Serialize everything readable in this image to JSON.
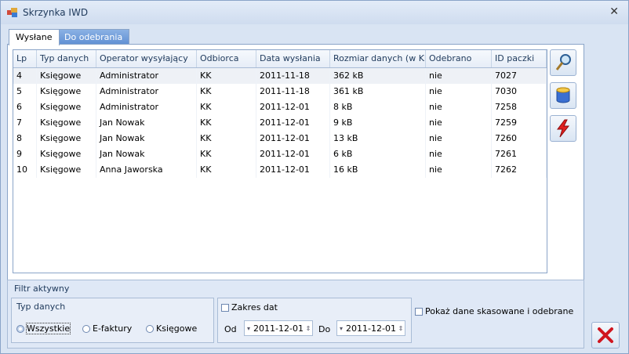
{
  "window": {
    "title": "Skrzynka IWD"
  },
  "tabs": [
    {
      "label": "Wysłane"
    },
    {
      "label": "Do odebrania"
    }
  ],
  "grid": {
    "columns": [
      "Lp",
      "Typ danych",
      "Operator wysyłający",
      "Odbiorca",
      "Data wysłania",
      "Rozmiar danych (w KB)",
      "Odebrano",
      "ID paczki"
    ],
    "rows": [
      [
        "4",
        "Księgowe",
        "Administrator",
        "KK",
        "2011-11-18",
        "362 kB",
        "nie",
        "7027"
      ],
      [
        "5",
        "Księgowe",
        "Administrator",
        "KK",
        "2011-11-18",
        "361 kB",
        "nie",
        "7030"
      ],
      [
        "6",
        "Księgowe",
        "Administrator",
        "KK",
        "2011-12-01",
        "8 kB",
        "nie",
        "7258"
      ],
      [
        "7",
        "Księgowe",
        "Jan Nowak",
        "KK",
        "2011-12-01",
        "9 kB",
        "nie",
        "7259"
      ],
      [
        "8",
        "Księgowe",
        "Jan Nowak",
        "KK",
        "2011-12-01",
        "13 kB",
        "nie",
        "7260"
      ],
      [
        "9",
        "Księgowe",
        "Jan Nowak",
        "KK",
        "2011-12-01",
        "6 kB",
        "nie",
        "7261"
      ],
      [
        "10",
        "Księgowe",
        "Anna Jaworska",
        "KK",
        "2011-12-01",
        "16 kB",
        "nie",
        "7262"
      ]
    ]
  },
  "side_buttons": [
    "search-icon",
    "database-icon",
    "lightning-icon"
  ],
  "filter": {
    "title": "Filtr aktywny",
    "type_group": {
      "title": "Typ danych",
      "options": [
        "Wszystkie",
        "E-faktury",
        "Księgowe"
      ],
      "selected": "Wszystkie"
    },
    "date_range": {
      "label": "Zakres dat",
      "checked": false,
      "from_label": "Od",
      "from_value": "2011-12-01",
      "to_label": "Do",
      "to_value": "2011-12-01"
    },
    "show_deleted": {
      "label": "Pokaż dane skasowane i odebrane",
      "checked": false
    }
  },
  "colors": {
    "accent": "#5f8fd3",
    "selected_row": "#eef1f6",
    "cancel": "#d0161f"
  }
}
